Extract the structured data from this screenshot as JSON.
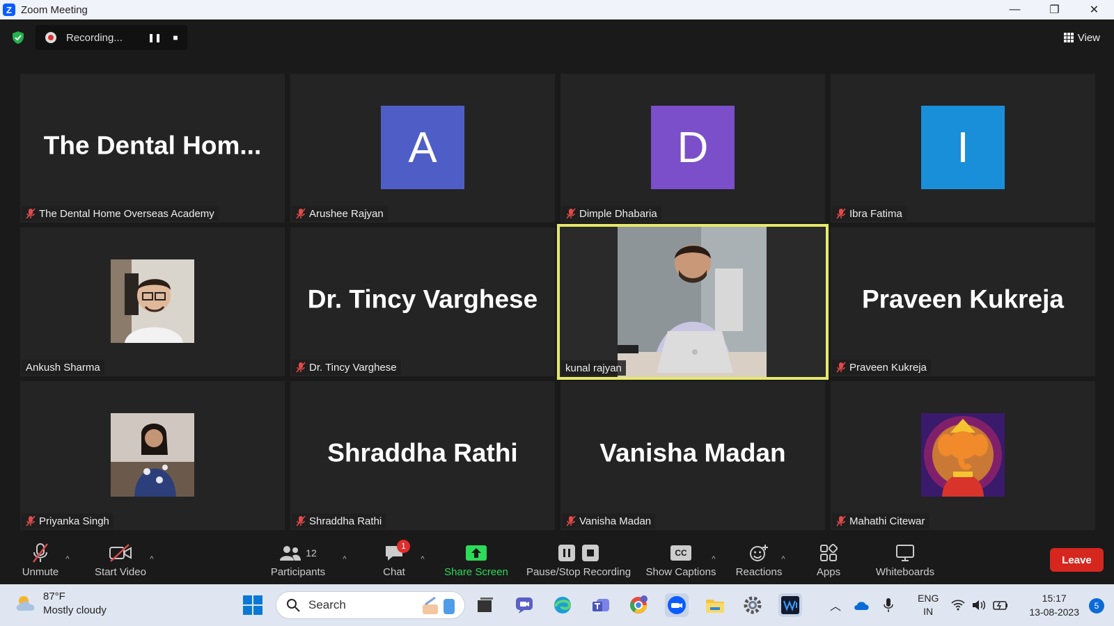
{
  "window": {
    "title": "Zoom Meeting",
    "logo_letter": "Z",
    "minimize": "—",
    "restore": "❐",
    "close": "✕"
  },
  "recording": {
    "status": "Recording...",
    "pause": "❚❚",
    "stop": "■"
  },
  "view_label": "View",
  "participants_tiles": [
    {
      "display": "The Dental Hom...",
      "name": "The Dental Home Overseas Academy",
      "muted": true
    },
    {
      "display": "A",
      "name": "Arushee Rajyan",
      "muted": true,
      "avatar_color": "#4f5ec6"
    },
    {
      "display": "D",
      "name": "Dimple Dhabaria",
      "muted": true,
      "avatar_color": "#7b4fc9"
    },
    {
      "display": "I",
      "name": "Ibra Fatima",
      "muted": true,
      "avatar_color": "#1a8fd9"
    },
    {
      "name": "Ankush Sharma",
      "muted": false
    },
    {
      "display": "Dr. Tincy Varghese",
      "name": "Dr. Tincy Varghese",
      "muted": true
    },
    {
      "name": "kunal rajyan",
      "muted": false,
      "active_speaker": true
    },
    {
      "display": "Praveen Kukreja",
      "name": "Praveen Kukreja",
      "muted": true
    },
    {
      "name": "Priyanka Singh",
      "muted": true
    },
    {
      "display": "Shraddha Rathi",
      "name": "Shraddha Rathi",
      "muted": true
    },
    {
      "display": "Vanisha Madan",
      "name": "Vanisha Madan",
      "muted": true
    },
    {
      "name": "Mahathi Citewar",
      "muted": true
    }
  ],
  "toolbar": {
    "unmute": "Unmute",
    "start_video": "Start Video",
    "participants": "Participants",
    "participants_count": "12",
    "chat": "Chat",
    "chat_badge": "1",
    "share_screen": "Share Screen",
    "pause_stop_recording": "Pause/Stop Recording",
    "show_captions": "Show Captions",
    "captions_icon_text": "CC",
    "reactions": "Reactions",
    "apps": "Apps",
    "whiteboards": "Whiteboards",
    "leave": "Leave"
  },
  "taskbar": {
    "temperature": "87°F",
    "weather": "Mostly cloudy",
    "search_placeholder": "Search",
    "language_top": "ENG",
    "language_bottom": "IN",
    "time": "15:17",
    "date": "13-08-2023",
    "notification_count": "5"
  },
  "colors": {
    "share_green": "#2ddb58",
    "leave_red": "#d6271f",
    "active_border": "#e6e96a"
  }
}
